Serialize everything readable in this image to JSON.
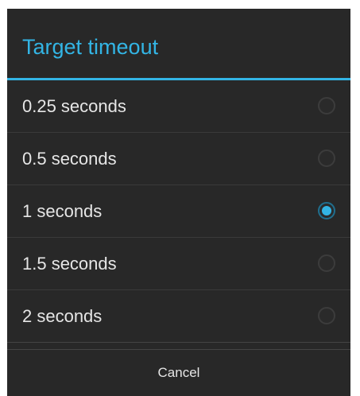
{
  "dialog": {
    "title": "Target timeout",
    "accent_color": "#33b5e5",
    "options": [
      {
        "label": "0.25 seconds",
        "selected": false
      },
      {
        "label": "0.5 seconds",
        "selected": false
      },
      {
        "label": "1 seconds",
        "selected": true
      },
      {
        "label": "1.5 seconds",
        "selected": false
      },
      {
        "label": "2 seconds",
        "selected": false
      }
    ],
    "cancel_label": "Cancel"
  }
}
